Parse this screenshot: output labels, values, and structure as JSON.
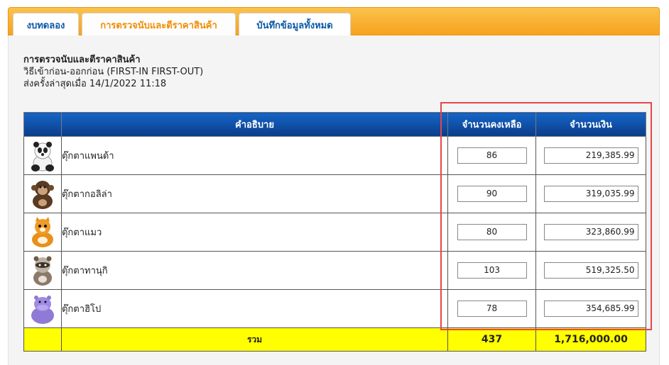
{
  "tabs": [
    {
      "label": "งบทดลอง"
    },
    {
      "label": "การตรวจนับและตีราคาสินค้า"
    },
    {
      "label": "บันทึกข้อมูลทั้งหมด"
    }
  ],
  "info": {
    "title": "การตรวจนับและตีราคาสินค้า",
    "method": "วิธีเข้าก่อน-ออกก่อน (FIRST-IN FIRST-OUT)",
    "last_sent": "ส่งครั้งล่าสุดเมื่อ 14/1/2022 11:18"
  },
  "table": {
    "headers": {
      "description": "คำอธิบาย",
      "quantity": "จำนวนคงเหลือ",
      "amount": "จำนวนเงิน"
    },
    "rows": [
      {
        "icon": "panda-toy-icon",
        "name": "ตุ๊กตาแพนด้า",
        "quantity": "86",
        "amount": "219,385.99"
      },
      {
        "icon": "gorilla-toy-icon",
        "name": "ตุ๊กตากอลิล่า",
        "quantity": "90",
        "amount": "319,035.99"
      },
      {
        "icon": "cat-toy-icon",
        "name": "ตุ๊กตาแมว",
        "quantity": "80",
        "amount": "323,860.99"
      },
      {
        "icon": "tanuki-toy-icon",
        "name": "ตุ๊กตาทานุกิ",
        "quantity": "103",
        "amount": "519,325.50"
      },
      {
        "icon": "hippo-toy-icon",
        "name": "ตุ๊กตาฮิโป",
        "quantity": "78",
        "amount": "354,685.99"
      }
    ],
    "total": {
      "label": "รวม",
      "quantity": "437",
      "amount": "1,716,000.00"
    }
  },
  "colors": {
    "tab_bar": "#f7a21c",
    "header_blue": "#0a3c88",
    "total_row": "#ffff00",
    "highlight": "#e8454a"
  }
}
